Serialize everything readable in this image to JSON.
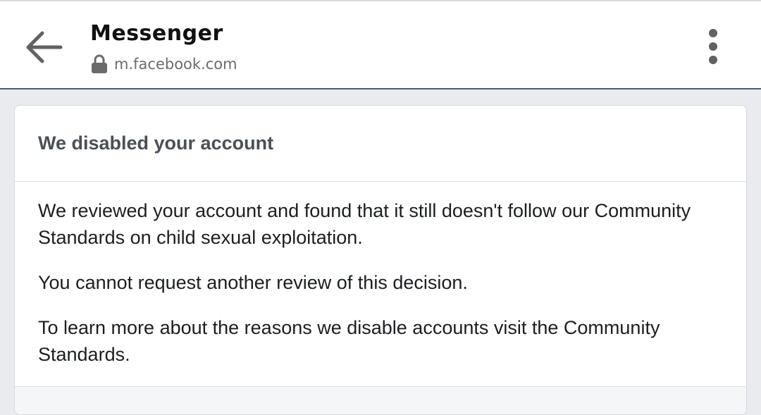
{
  "header": {
    "app_title": "Messenger",
    "url": "m.facebook.com",
    "icons": {
      "back": "arrow-left-icon",
      "lock": "lock-icon",
      "menu": "more-vertical-icon"
    }
  },
  "card": {
    "title": "We disabled your account",
    "paragraphs": [
      "We reviewed your account and found that it still doesn't follow our Community Standards on child sexual exploitation.",
      "You cannot request another review of this decision.",
      "To learn more about the reasons we disable accounts visit the Community Standards."
    ]
  },
  "colors": {
    "topbar_border": "#4b5a73",
    "background": "#e9ebee",
    "text": "#1c1e21",
    "title_text": "#4b4f56"
  }
}
